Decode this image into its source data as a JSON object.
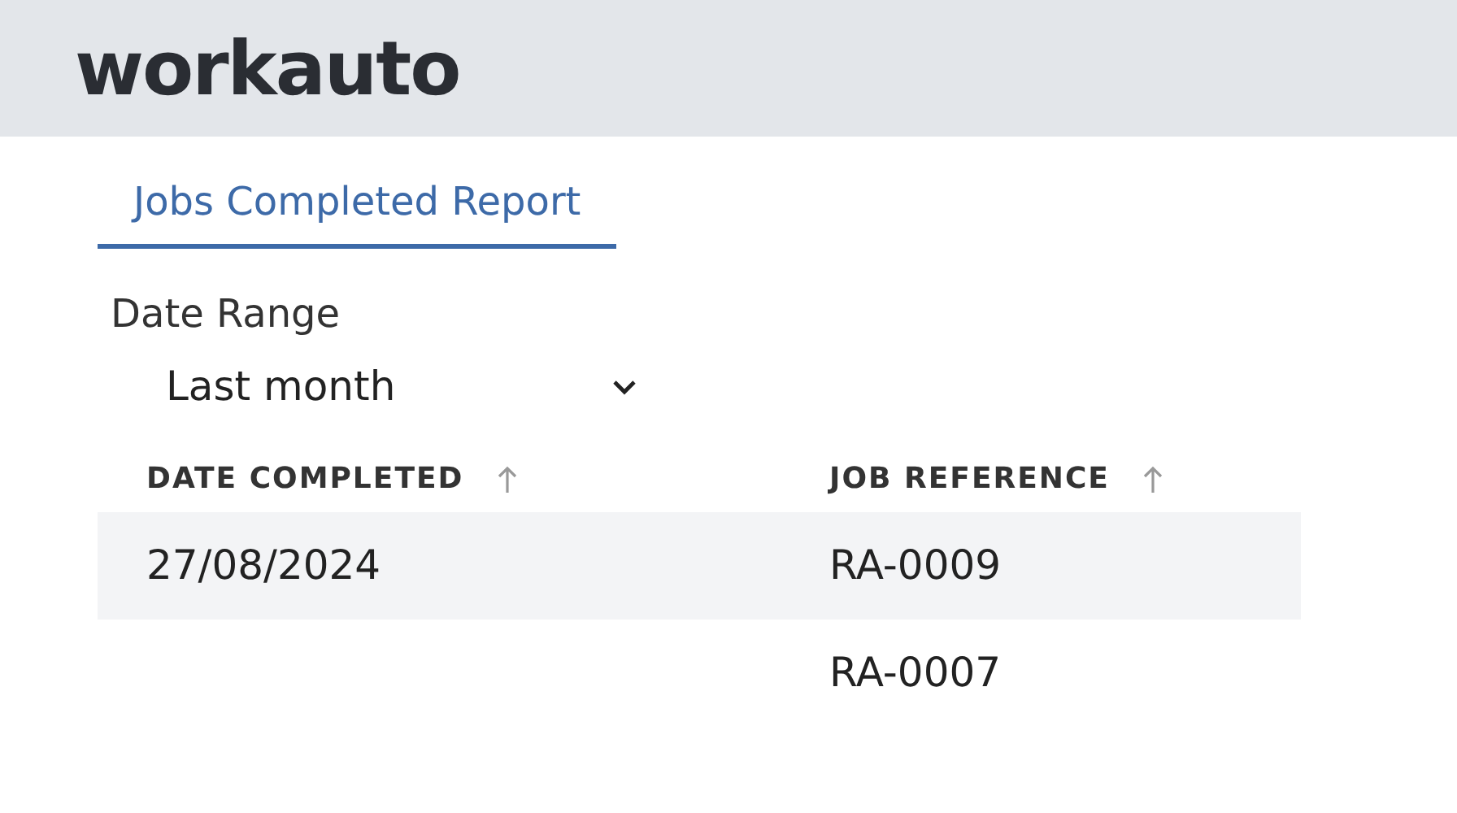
{
  "header": {
    "logo": "workauto"
  },
  "tabs": [
    {
      "label": "Jobs Completed Report",
      "selected": true
    }
  ],
  "filter": {
    "label": "Date Range",
    "value": "Last month"
  },
  "table": {
    "columns": [
      {
        "label": "DATE COMPLETED"
      },
      {
        "label": "JOB REFERENCE"
      }
    ],
    "rows": [
      {
        "date_completed": "27/08/2024",
        "job_reference": "RA-0009"
      },
      {
        "job_reference": "RA-0007"
      }
    ]
  }
}
